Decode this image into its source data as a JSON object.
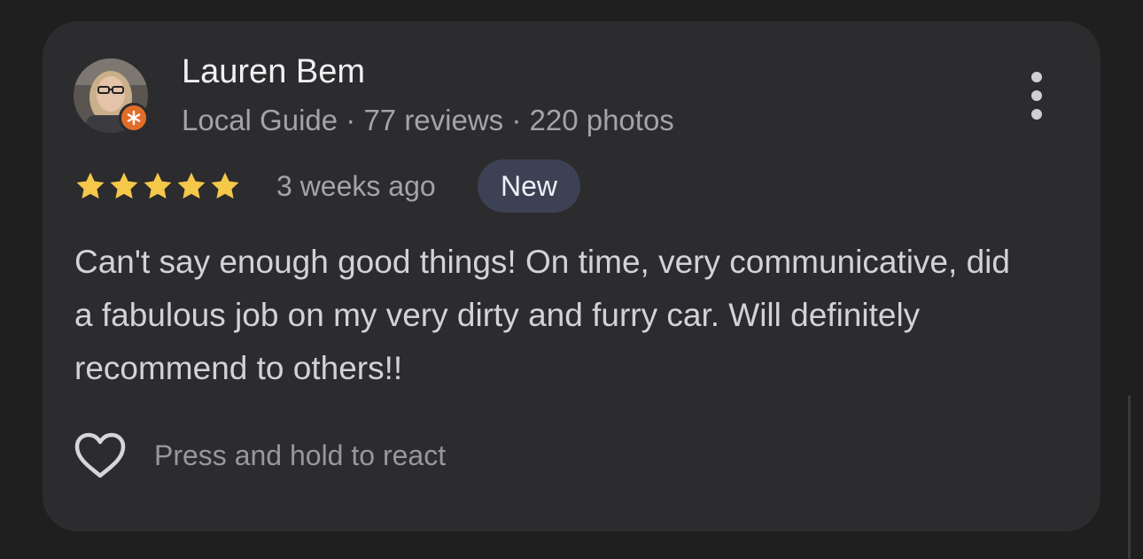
{
  "review": {
    "reviewer_name": "Lauren Bem",
    "reviewer_meta": "Local Guide · 77 reviews · 220 photos",
    "rating": 5,
    "rating_max": 5,
    "time_ago": "3 weeks ago",
    "badge": "New",
    "text": "Can't say enough good things! On time, very communicative, did a fabulous job on my very dirty and furry car. Will definitely recommend to others!!",
    "react_label": "Press and hold to react"
  },
  "icons": {
    "star": "star-icon",
    "more": "more-vertical-icon",
    "heart": "heart-outline-icon",
    "guide": "local-guide-star-icon"
  },
  "colors": {
    "background": "#1f1f20",
    "card": "#2c2c2e",
    "star": "#f5c84a",
    "badge_bg": "#3d4154",
    "guide_badge": "#e06d2a"
  }
}
